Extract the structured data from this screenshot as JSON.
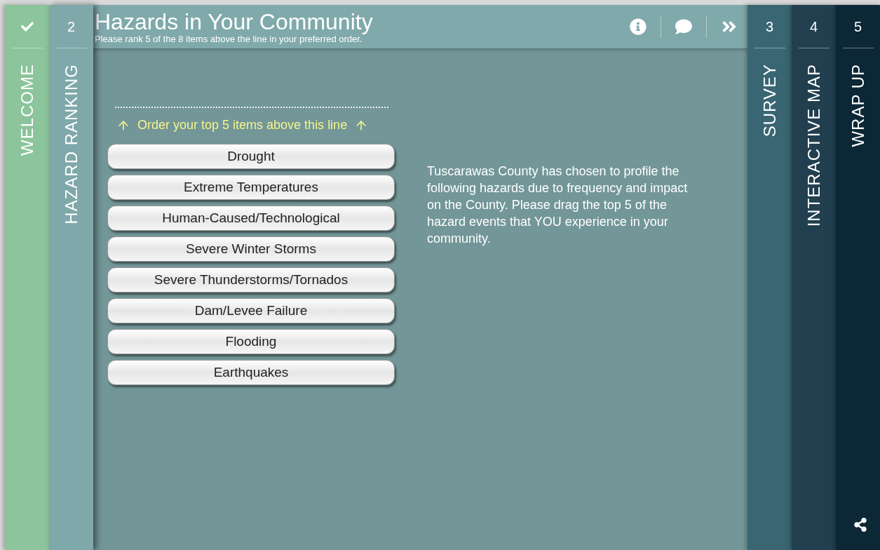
{
  "steps_left": [
    {
      "label": "WELCOME",
      "completed": true,
      "selected": false,
      "color": "#8cc49c"
    },
    {
      "number": "2",
      "label": "HAZARD RANKING",
      "completed": false,
      "selected": true,
      "color": "#7fa8aa"
    }
  ],
  "header": {
    "title": "Hazards in Your Community",
    "subtitle": "Please rank 5 of the 8 items above the line in your preferred order."
  },
  "instruction": "Order your top 5 items above this line",
  "hazards": [
    "Drought",
    "Extreme Temperatures",
    "Human-Caused/Technological",
    "Severe Winter Storms",
    "Severe Thunderstorms/Tornados",
    "Dam/Levee Failure",
    "Flooding",
    "Earthquakes"
  ],
  "description": "Tuscarawas County has chosen to profile the following hazards due to frequency and impact on the County. Please drag the top 5 of the hazard events that YOU experience in your community.",
  "steps_right": [
    {
      "number": "3",
      "label": "SURVEY",
      "completed": false,
      "selected": false,
      "color": "#396672"
    },
    {
      "number": "4",
      "label": "INTERACTIVE MAP",
      "completed": false,
      "selected": false,
      "color": "#213f4f"
    },
    {
      "number": "5",
      "label": "WRAP UP",
      "completed": false,
      "selected": false,
      "color": "#0c2736"
    }
  ]
}
